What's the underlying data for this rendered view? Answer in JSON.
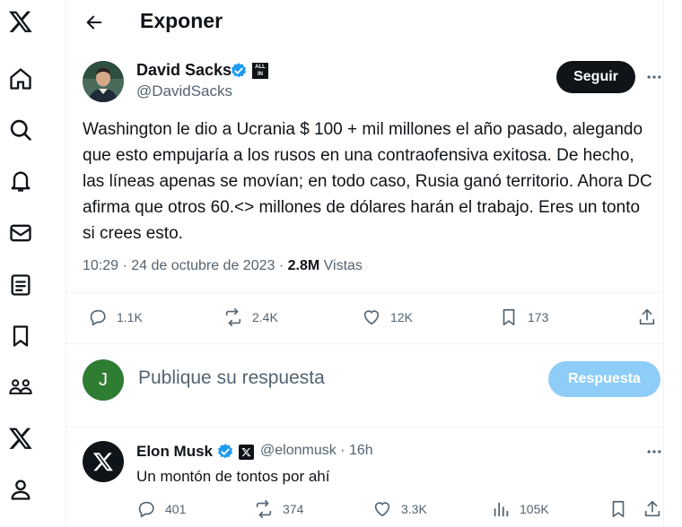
{
  "sidebar": {
    "items": [
      {
        "icon": "x-logo-icon"
      },
      {
        "icon": "home-icon"
      },
      {
        "icon": "search-icon"
      },
      {
        "icon": "bell-icon"
      },
      {
        "icon": "mail-icon"
      },
      {
        "icon": "list-icon"
      },
      {
        "icon": "bookmark-icon"
      },
      {
        "icon": "communities-icon"
      },
      {
        "icon": "premium-x-icon"
      },
      {
        "icon": "profile-icon"
      }
    ]
  },
  "header": {
    "title": "Exponer"
  },
  "tweet": {
    "author_name": "David Sacks",
    "handle": "@DavidSacks",
    "follow_label": "Seguir",
    "badge_label": "ALL IN",
    "text": "Washington le dio a Ucrania $ 100 + mil millones el año pasado, alegando que esto empujaría a los rusos en una contraofensiva exitosa. De hecho, las líneas apenas se movían; en todo caso, Rusia ganó territorio. Ahora DC afirma que otros 60.<> millones de dólares harán el trabajo. Eres un tonto si crees esto.",
    "time": "10:29 · 24 de octubre de 2023 · ",
    "views_count": "2.8M",
    "views_label": " Vistas",
    "stats": {
      "replies": "1.1K",
      "reposts": "2.4K",
      "likes": "12K",
      "bookmarks": "173"
    }
  },
  "reply_box": {
    "avatar_letter": "J",
    "placeholder": "Publique su respuesta",
    "button_label": "Respuesta"
  },
  "reply": {
    "author_name": "Elon Musk",
    "handle_time": "@elonmusk · 16h",
    "text": "Un montón de tontos por ahí",
    "stats": {
      "replies": "401",
      "reposts": "374",
      "likes": "3.3K",
      "views": "105K"
    }
  },
  "colors": {
    "accent": "#1d9bf0",
    "reply_button": "#8ecdf8",
    "avatar_j": "#2e7d32"
  }
}
